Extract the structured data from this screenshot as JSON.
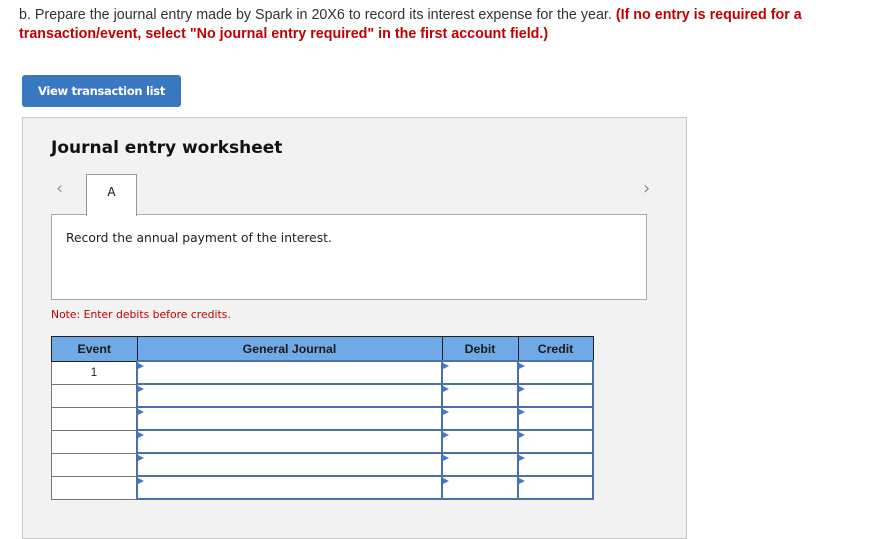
{
  "question": {
    "prompt": "b. Prepare the journal entry made by Spark in 20X6 to record its interest expense for the year.",
    "instruction": "(If no entry is required for a transaction/event, select \"No journal entry required\" in the first account field.)"
  },
  "buttons": {
    "view_transaction_list": "View transaction list"
  },
  "worksheet": {
    "title": "Journal entry worksheet",
    "prev_icon": "chevron-left-icon",
    "next_icon": "chevron-right-icon",
    "tabs": [
      {
        "label": "A",
        "active": true
      }
    ],
    "description": "Record the annual payment of the interest.",
    "note": "Note: Enter debits before credits.",
    "table": {
      "headers": [
        "Event",
        "General Journal",
        "Debit",
        "Credit"
      ],
      "rows": [
        {
          "event": "1",
          "account": "",
          "debit": "",
          "credit": ""
        },
        {
          "event": "",
          "account": "",
          "debit": "",
          "credit": ""
        },
        {
          "event": "",
          "account": "",
          "debit": "",
          "credit": ""
        },
        {
          "event": "",
          "account": "",
          "debit": "",
          "credit": ""
        },
        {
          "event": "",
          "account": "",
          "debit": "",
          "credit": ""
        },
        {
          "event": "",
          "account": "",
          "debit": "",
          "credit": ""
        }
      ]
    }
  },
  "colors": {
    "accent_button": "#3a78c2",
    "instruction_red": "#c00000",
    "table_header": "#6fa9e6"
  }
}
